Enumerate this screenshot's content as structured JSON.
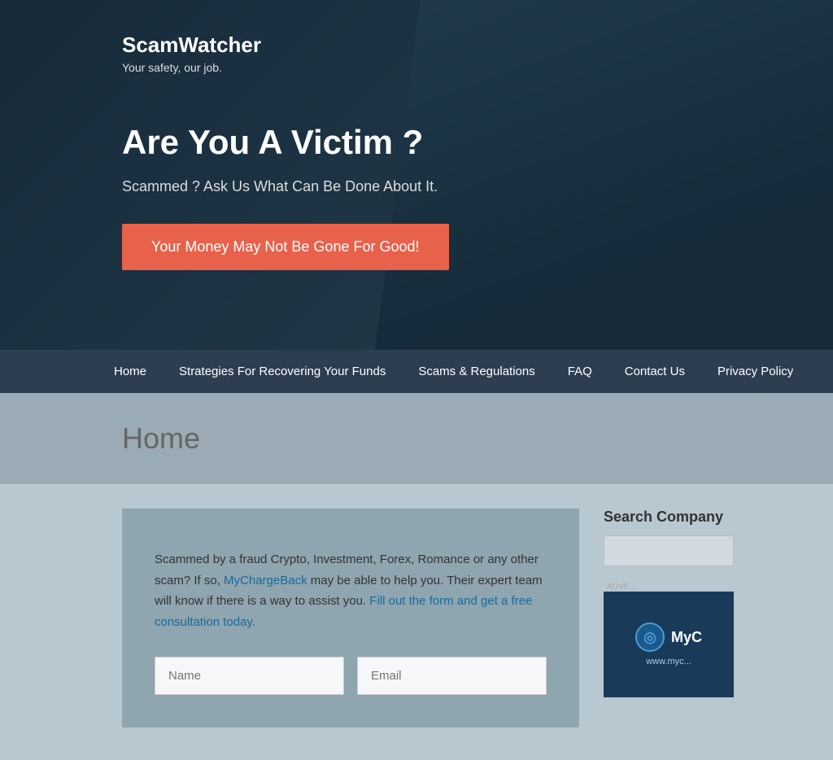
{
  "hero": {
    "logo": "ScamWatcher",
    "tagline": "Your safety, our job.",
    "headline": "Are You A Victim ?",
    "subtext": "Scammed ? Ask Us What Can Be Done About It.",
    "cta_label": "Your Money May Not Be Gone For Good!"
  },
  "navbar": {
    "items": [
      {
        "label": "Home",
        "id": "home"
      },
      {
        "label": "Strategies For Recovering Your Funds",
        "id": "strategies"
      },
      {
        "label": "Scams & Regulations",
        "id": "scams"
      },
      {
        "label": "FAQ",
        "id": "faq"
      },
      {
        "label": "Contact Us",
        "id": "contact"
      },
      {
        "label": "Privacy Policy",
        "id": "privacy"
      }
    ]
  },
  "page_title": "Home",
  "content_card": {
    "text_part1": "Scammed by a fraud Crypto, Investment, Forex, Romance or any other scam? If so,",
    "link1": "MyChargeBack",
    "text_part2": "may be able to help you.",
    "text_part3": "Their expert team will know if there is a way to assist you.",
    "link2": "Fill out the form and get a free consultation today.",
    "name_placeholder": "Name",
    "email_placeholder": "Email"
  },
  "sidebar": {
    "search_title": "Search Company",
    "ad_logo_text": "MyC",
    "ad_url": "www.myc..."
  }
}
